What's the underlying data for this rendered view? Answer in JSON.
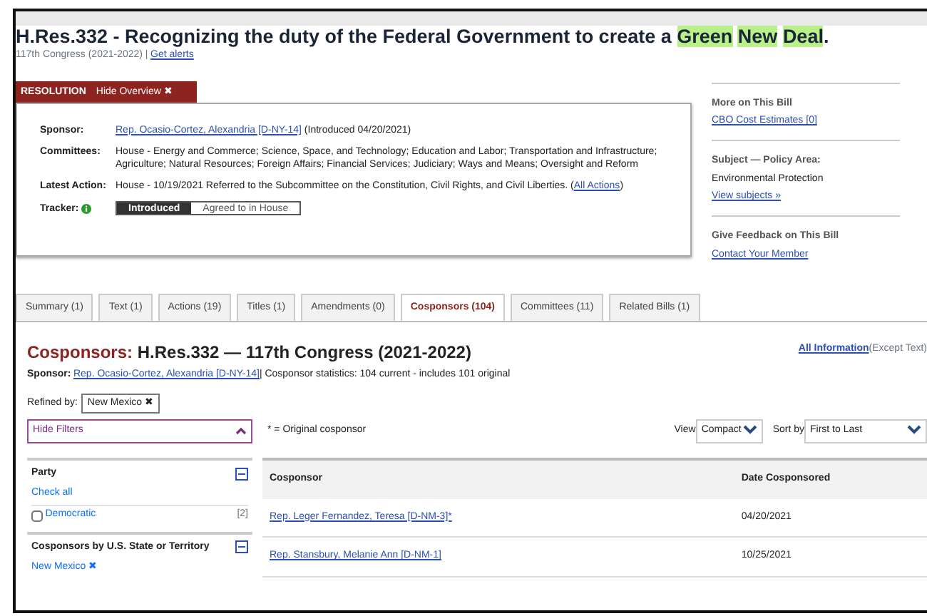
{
  "title_segments": [
    {
      "text": "H.Res.332 - Recognizing the duty of the Federal Government to create a ",
      "highlighted": false
    },
    {
      "text": "Green",
      "highlighted": true
    },
    {
      "text": "New",
      "highlighted": true
    },
    {
      "text": "Deal",
      "highlighted": true
    },
    {
      "text": ".",
      "highlighted": false
    }
  ],
  "subtitle": {
    "congress": "117th Congress (2021-2022) |",
    "alerts_link": "Get alerts"
  },
  "overview": {
    "type_label": "RESOLUTION",
    "hide_button": "Hide Overview ✖",
    "fields": [
      {
        "label": "Sponsor:",
        "link": "Rep. Ocasio-Cortez, Alexandria [D-NY-14]",
        "text": " (Introduced 04/20/2021)"
      },
      {
        "label": "Committees:",
        "text": "House - Energy and Commerce; Science, Space, and Technology; Education and Labor; Transportation and Infrastructure; Agriculture; Natural Resources; Foreign Affairs; Financial Services; Judiciary; Ways and Means; Oversight and Reform"
      },
      {
        "label": "Latest Action:",
        "text": "House - 10/19/2021 Referred to the Subcommittee on the Constitution, Civil Rights, and Civil Liberties.  (",
        "link": "All Actions",
        "after": ")"
      }
    ],
    "tracker": {
      "label": "Tracker:",
      "steps": [
        {
          "text": "Introduced",
          "selected": true
        },
        {
          "text": "Agreed to in House",
          "selected": false
        }
      ]
    }
  },
  "sidebar": [
    {
      "heading": "More on This Bill",
      "lines": [
        {
          "text": "CBO Cost Estimates [0]",
          "kind": "link"
        }
      ]
    },
    {
      "heading": "Subject — Policy Area:",
      "lines": [
        {
          "text": "Environmental Protection",
          "kind": "text"
        },
        {
          "text": "View subjects »",
          "kind": "link"
        }
      ]
    },
    {
      "heading": "Give Feedback on This Bill",
      "lines": [
        {
          "text": "Contact Your Member",
          "kind": "link"
        }
      ]
    }
  ],
  "tabs": [
    {
      "label": "Summary (1)",
      "selected": false
    },
    {
      "label": "Text (1)",
      "selected": false
    },
    {
      "label": "Actions (19)",
      "selected": false
    },
    {
      "label": "Titles (1)",
      "selected": false
    },
    {
      "label": "Amendments (0)",
      "selected": false
    },
    {
      "label": "Cosponsors (104)",
      "selected": true
    },
    {
      "label": "Committees (11)",
      "selected": false
    },
    {
      "label": "Related Bills (1)",
      "selected": false
    }
  ],
  "section": {
    "heading_accent": "Cosponsors:",
    "heading": " H.Res.332 — 117th Congress (2021-2022)",
    "all_info_link": "All Information",
    "all_info_note": " (Except Text)",
    "sponsor_label": "Sponsor:",
    "sponsor_link": "Rep. Ocasio-Cortez, Alexandria [D-NY-14]",
    "stats": " | Cosponsor statistics: 104 current - includes 101 original",
    "refined_label": "Refined by:",
    "refined_tag": "New Mexico ✖",
    "hide_filters": "Hide Filters",
    "legend": "* = Original cosponsor",
    "view_label": "View",
    "view_value": "Compact",
    "sort_label": "Sort by",
    "sort_value": "First to Last"
  },
  "filters": [
    {
      "heading": "Party",
      "items": [
        {
          "kind": "link",
          "text": "Check all"
        },
        {
          "kind": "checkbox",
          "text": "Democratic",
          "count": "[2]",
          "checked": false
        }
      ]
    },
    {
      "heading": "Cosponsors by U.S. State or Territory",
      "items": [
        {
          "kind": "link",
          "text": "New Mexico ✖"
        }
      ]
    }
  ],
  "table": {
    "columns": [
      "Cosponsor",
      "Date Cosponsored"
    ],
    "rows": [
      {
        "cosponsor": "Rep. Leger Fernandez, Teresa [D-NM-3]*",
        "date": "04/20/2021"
      },
      {
        "cosponsor": "Rep. Stansbury, Melanie Ann [D-NM-1]",
        "date": "10/25/2021"
      }
    ]
  }
}
